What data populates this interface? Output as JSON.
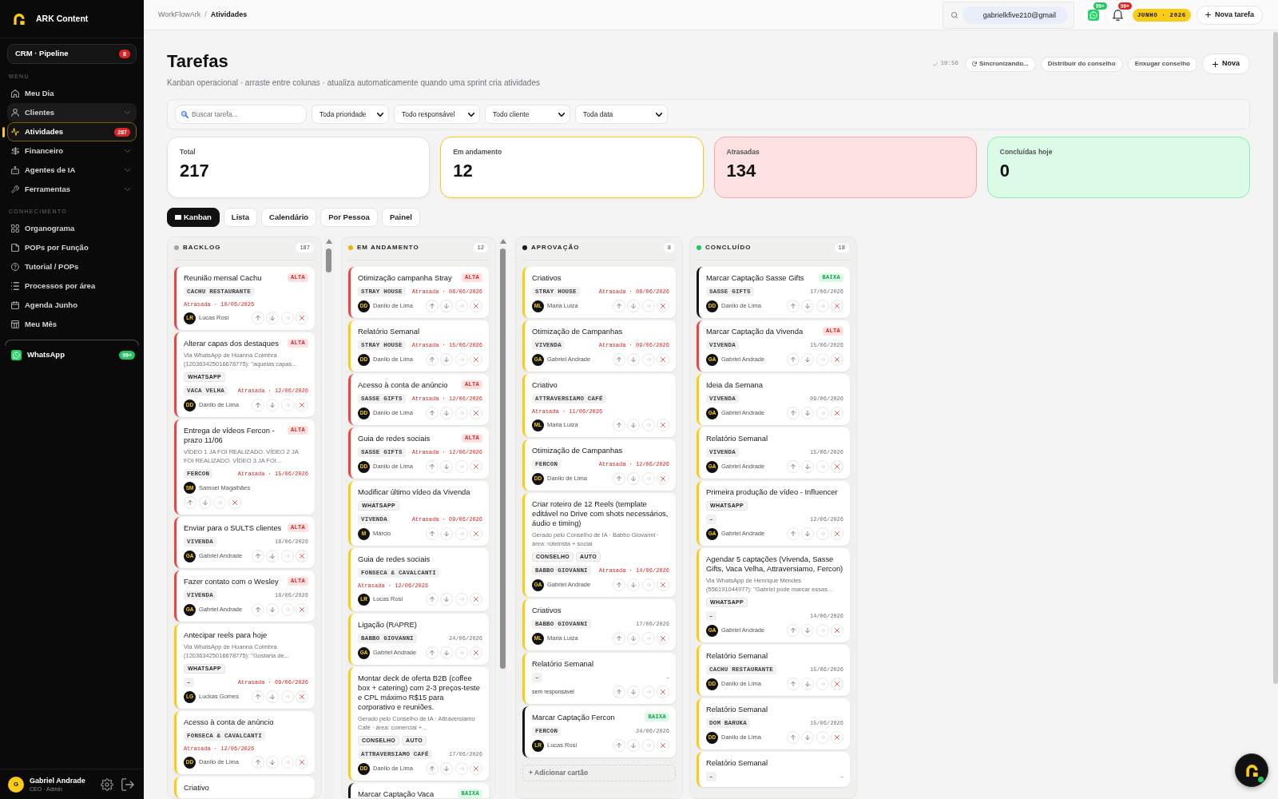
{
  "sidebar": {
    "brand": "ARK Content",
    "pipeline": {
      "label": "CRM · Pipeline",
      "badge": "8"
    },
    "sections": [
      {
        "title": "MENU",
        "items": [
          {
            "label": "Meu Dia",
            "selected": false,
            "highlighted": false,
            "submenu": false
          },
          {
            "label": "Clientes",
            "selected": false,
            "highlighted": true,
            "submenu": true
          },
          {
            "label": "Atividades",
            "selected": true,
            "highlighted": false,
            "submenu": false,
            "badge": "287"
          },
          {
            "label": "Financeiro",
            "selected": false,
            "highlighted": false,
            "submenu": true
          },
          {
            "label": "Agentes de IA",
            "selected": false,
            "highlighted": false,
            "submenu": true
          },
          {
            "label": "Ferramentas",
            "selected": false,
            "highlighted": false,
            "submenu": true
          }
        ]
      },
      {
        "title": "CONHECIMENTO",
        "items": [
          {
            "label": "Organograma",
            "selected": false,
            "highlighted": false,
            "submenu": false
          },
          {
            "label": "POPs por Função",
            "selected": false,
            "highlighted": false,
            "submenu": false
          },
          {
            "label": "Tutorial / POPs",
            "selected": false,
            "highlighted": false,
            "submenu": false
          },
          {
            "label": "Processos por área",
            "selected": false,
            "highlighted": false,
            "submenu": false
          },
          {
            "label": "Agenda Junho",
            "selected": false,
            "highlighted": false,
            "submenu": false
          },
          {
            "label": "Meu Mês",
            "selected": false,
            "highlighted": false,
            "submenu": false
          }
        ]
      }
    ],
    "whatsapp": {
      "label": "WhatsApp",
      "badge": "99+"
    },
    "user": {
      "initial": "G",
      "name": "Gabriel Andrade",
      "role": "CEO · Admin"
    }
  },
  "topbar": {
    "breadcrumb": {
      "items": [
        "WorkFlowArk",
        "Atividades"
      ],
      "separator": "/"
    },
    "search": {
      "value": "gabrielkfive210@gmail"
    },
    "whatsapp_badge": "99+",
    "notifications_badge": "99+",
    "period": "JUNHO · 2026",
    "new_task_button": "Nova tarefa"
  },
  "page": {
    "title": "Tarefas",
    "subtitle": "Kanban operacional · arraste entre colunas · atualiza automaticamente quando uma sprint cria atividades",
    "sync_time": "10:56",
    "actions": [
      {
        "label": "Sincronizando...",
        "kind": "sync"
      },
      {
        "label": "Distribuir do conselho",
        "kind": "plain"
      },
      {
        "label": "Enxugar conselho",
        "kind": "plain"
      },
      {
        "label": "Nova",
        "kind": "primary"
      }
    ]
  },
  "filters": {
    "search": {
      "placeholder": "Buscar tarefa..."
    },
    "selects": [
      "Toda prioridade",
      "Todo responsável",
      "Todo cliente",
      "Toda data"
    ]
  },
  "stats": [
    {
      "label": "Total",
      "value": "217",
      "kind": "total"
    },
    {
      "label": "Em andamento",
      "value": "12",
      "kind": "progress"
    },
    {
      "label": "Atrasadas",
      "value": "134",
      "kind": "overdue"
    },
    {
      "label": "Concluídas hoje",
      "value": "0",
      "kind": "done"
    }
  ],
  "views": [
    {
      "label": "Kanban",
      "selected": true
    },
    {
      "label": "Lista",
      "selected": false
    },
    {
      "label": "Calendário",
      "selected": false
    },
    {
      "label": "Por Pessoa",
      "selected": false
    },
    {
      "label": "Painel",
      "selected": false
    }
  ],
  "board": {
    "columns": [
      {
        "title": "BACKLOG",
        "color": "#a1a1aa",
        "count": "187",
        "scrollbar": true,
        "cards": [
          {
            "title": "Reunião mensal Cachu",
            "kind": "high",
            "badge": "ALTA",
            "client": "CACHU RESTAURANTE",
            "due": "Atrasada · 10/06/2026",
            "overdue": true,
            "assignee": {
              "initials": "LR",
              "name": "Lucas Rosi"
            }
          },
          {
            "title": "Alterar capas dos destaques",
            "kind": "high",
            "badge": "ALTA",
            "description": "Via WhatsApp de Hoanna Coimbra (120363425016678775): \"aquelas capas...",
            "tags": [
              "WHATSAPP"
            ],
            "client": "VACA VELHA",
            "due": "Atrasada · 12/06/2026",
            "overdue": true,
            "assignee": {
              "initials": "DD",
              "name": "Danilo de Lima"
            }
          },
          {
            "title": "Entrega de vídeos Fercon - prazo 11/06",
            "kind": "high",
            "badge": "ALTA",
            "description": "VÍDEO 1 JA FOI REALIZADO. VÍDEO 2 JA FOI REALIZADO. VÍDEO 3 JA FOI...",
            "client": "FERCON",
            "due": "Atrasada · 15/06/2026",
            "overdue": true,
            "assignee": {
              "initials": "SM",
              "name": "Samuel Magalhães"
            }
          },
          {
            "title": "Enviar para o SULTS clientes",
            "kind": "high",
            "badge": "ALTA",
            "client": "VIVENDA",
            "due": "18/06/2026",
            "overdue": false,
            "assignee": {
              "initials": "GA",
              "name": "Gabriel Andrade"
            }
          },
          {
            "title": "Fazer contato com o Wesley",
            "kind": "high",
            "badge": "ALTA",
            "client": "VIVENDA",
            "due": "18/06/2026",
            "overdue": false,
            "assignee": {
              "initials": "GA",
              "name": "Gabriel Andrade"
            }
          },
          {
            "title": "Antecipar reels para hoje",
            "kind": "medium",
            "description": "Via WhatsApp de Hoanna Coimbra (120363425016678775): \"Gostaria de...",
            "tags": [
              "WHATSAPP"
            ],
            "client": "–",
            "due": "Atrasada · 09/06/2026",
            "overdue": true,
            "assignee": {
              "initials": "LG",
              "name": "Luckas Gomes"
            }
          },
          {
            "title": "Acesso à conta de anúncio",
            "kind": "medium",
            "client": "FONSECA & CAVALCANTI",
            "due": "Atrasada · 12/06/2026",
            "overdue": true,
            "assignee": {
              "initials": "DD",
              "name": "Danilo de Lima"
            }
          },
          {
            "title": "Criativo",
            "kind": "medium"
          }
        ]
      },
      {
        "title": "EM ANDAMENTO",
        "color": "#eab308",
        "count": "12",
        "scrollbar": true,
        "cards": [
          {
            "title": "Otimização campanha Stray",
            "kind": "high",
            "badge": "ALTA",
            "client": "STRAY HOUSE",
            "due": "Atrasada · 06/06/2026",
            "overdue": true,
            "assignee": {
              "initials": "DD",
              "name": "Danilo de Lima"
            }
          },
          {
            "title": "Relatório Semanal",
            "kind": "medium",
            "client": "STRAY HOUSE",
            "due": "Atrasada · 15/06/2026",
            "overdue": true,
            "assignee": {
              "initials": "DD",
              "name": "Danilo de Lima"
            }
          },
          {
            "title": "Acesso à conta de anúncio",
            "kind": "high",
            "badge": "ALTA",
            "client": "SASSE GIFTS",
            "due": "Atrasada · 12/06/2026",
            "overdue": true,
            "assignee": {
              "initials": "DD",
              "name": "Danilo de Lima"
            }
          },
          {
            "title": "Guia de redes sociais",
            "kind": "high",
            "badge": "ALTA",
            "client": "SASSE GIFTS",
            "due": "Atrasada · 12/06/2026",
            "overdue": true,
            "assignee": {
              "initials": "DD",
              "name": "Danilo de Lima"
            }
          },
          {
            "title": "Modificar último vídeo da Vivenda",
            "kind": "medium",
            "tags": [
              "WHATSAPP"
            ],
            "client": "VIVENDA",
            "due": "Atrasada · 09/06/2026",
            "overdue": true,
            "assignee": {
              "initials": "M",
              "name": "Márcio"
            }
          },
          {
            "title": "Guia de redes sociais",
            "kind": "medium",
            "client": "FONSECA & CAVALCANTI",
            "due": "Atrasada · 12/06/2026",
            "overdue": true,
            "assignee": {
              "initials": "LR",
              "name": "Lucas Rosi"
            }
          },
          {
            "title": "Ligação (RAPRE)",
            "kind": "medium",
            "client": "BABBO GIOVANNI",
            "due": "24/06/2026",
            "overdue": false,
            "assignee": {
              "initials": "GA",
              "name": "Gabriel Andrade"
            }
          },
          {
            "title": "Montar deck de oferta B2B (coffee box + catering) com 2-3 preços-teste e CPL máximo R$15 para corporativo e reuniões.",
            "kind": "medium",
            "description": "Gerado pelo Conselho de IA · Attraversiamo Café · área: comercial +...",
            "tags": [
              "CONSELHO",
              "AUTO"
            ],
            "client": "ATTRAVERSIAMO CAFÉ",
            "due": "17/06/2026",
            "overdue": false,
            "assignee": {
              "initials": "DD",
              "name": "Danilo de Lima"
            }
          },
          {
            "title": "Marcar Captação Vaca",
            "kind": "low",
            "badge": "BAIXA"
          }
        ]
      },
      {
        "title": "APROVAÇÃO",
        "color": "#18181b",
        "count": "8",
        "scrollbar": false,
        "add_label": "+ Adicionar cartão",
        "cards": [
          {
            "title": "Criativos",
            "kind": "medium",
            "client": "STRAY HOUSE",
            "due": "Atrasada · 08/06/2026",
            "overdue": true,
            "assignee": {
              "initials": "ML",
              "name": "Maria Luiza"
            }
          },
          {
            "title": "Otimização de Campanhas",
            "kind": "medium",
            "client": "VIVENDA",
            "due": "Atrasada · 09/06/2026",
            "overdue": true,
            "assignee": {
              "initials": "GA",
              "name": "Gabriel Andrade"
            }
          },
          {
            "title": "Criativo",
            "kind": "medium",
            "client": "ATTRAVERSIAMO CAFÉ",
            "due": "Atrasada · 11/06/2026",
            "overdue": true,
            "assignee": {
              "initials": "ML",
              "name": "Maria Luiza"
            }
          },
          {
            "title": "Otimização de Campanhas",
            "kind": "medium",
            "client": "FERCON",
            "due": "Atrasada · 12/06/2026",
            "overdue": true,
            "assignee": {
              "initials": "DD",
              "name": "Danilo de Lima"
            }
          },
          {
            "title": "Criar roteiro de 12 Reels (template editável no Drive com shots necessários, áudio e timing)",
            "kind": "medium",
            "description": "Gerado pelo Conselho de IA · Babbo Giovanni · área: roteirista + social",
            "tags": [
              "CONSELHO",
              "AUTO"
            ],
            "client": "BABBO GIOVANNI",
            "due": "Atrasada · 14/06/2026",
            "overdue": true,
            "assignee": {
              "initials": "GA",
              "name": "Gabriel Andrade"
            }
          },
          {
            "title": "Criativos",
            "kind": "medium",
            "client": "BABBO GIOVANNI",
            "due": "17/06/2026",
            "overdue": false,
            "assignee": {
              "initials": "ML",
              "name": "Maria Luiza"
            }
          },
          {
            "title": "Relatório Semanal",
            "kind": "medium",
            "client": "–",
            "due": "–",
            "overdue": false,
            "assignee": {
              "name": "sem responsável"
            }
          },
          {
            "title": "Marcar Captação Fercon",
            "kind": "low",
            "badge": "BAIXA",
            "client": "FERCON",
            "due": "24/06/2026",
            "overdue": false,
            "assignee": {
              "initials": "LR",
              "name": "Lucas Rosi"
            }
          }
        ]
      },
      {
        "title": "CONCLUÍDO",
        "color": "#22c55e",
        "count": "18",
        "scrollbar": false,
        "cards": [
          {
            "title": "Marcar Captação Sasse Gifts",
            "kind": "low",
            "badge": "BAIXA",
            "client": "SASSE GIFTS",
            "due": "17/06/2026",
            "overdue": false,
            "assignee": {
              "initials": "DD",
              "name": "Danilo de Lima"
            }
          },
          {
            "title": "Marcar Captação da Vivenda",
            "kind": "high",
            "badge": "ALTA",
            "client": "VIVENDA",
            "due": "15/06/2026",
            "overdue": false,
            "assignee": {
              "initials": "GA",
              "name": "Gabriel Andrade"
            }
          },
          {
            "title": "Ideia da Semana",
            "kind": "medium",
            "client": "VIVENDA",
            "due": "09/06/2026",
            "overdue": false,
            "assignee": {
              "initials": "GA",
              "name": "Gabriel Andrade"
            }
          },
          {
            "title": "Relatório Semanal",
            "kind": "medium",
            "client": "VIVENDA",
            "due": "15/06/2026",
            "overdue": false,
            "assignee": {
              "initials": "GA",
              "name": "Gabriel Andrade"
            }
          },
          {
            "title": "Primeira produção de vídeo - Influencer",
            "kind": "medium",
            "tags": [
              "WHATSAPP"
            ],
            "client": "–",
            "due": "12/06/2026",
            "overdue": false,
            "assignee": {
              "initials": "GA",
              "name": "Gabriel Andrade"
            }
          },
          {
            "title": "Agendar 5 captações (Vivenda, Sasse Gifts, Vaca Velha, Attraversiamo, Fercon)",
            "kind": "medium",
            "description": "Via WhatsApp de Henrique Mendes (556191044977): \"Gabriel pode marcar essas...",
            "tags": [
              "WHATSAPP"
            ],
            "client": "–",
            "due": "14/06/2026",
            "overdue": false,
            "assignee": {
              "initials": "GA",
              "name": "Gabriel Andrade"
            }
          },
          {
            "title": "Relatório Semanal",
            "kind": "medium",
            "client": "CACHU RESTAURANTE",
            "due": "15/06/2026",
            "overdue": false,
            "assignee": {
              "initials": "DD",
              "name": "Danilo de Lima"
            }
          },
          {
            "title": "Relatório Semanal",
            "kind": "medium",
            "client": "DOM BARUKA",
            "due": "15/06/2026",
            "overdue": false,
            "assignee": {
              "initials": "DD",
              "name": "Danilo de Lima"
            }
          },
          {
            "title": "Relatório Semanal",
            "kind": "medium",
            "client": "–",
            "due": "–",
            "overdue": false
          }
        ]
      }
    ]
  }
}
